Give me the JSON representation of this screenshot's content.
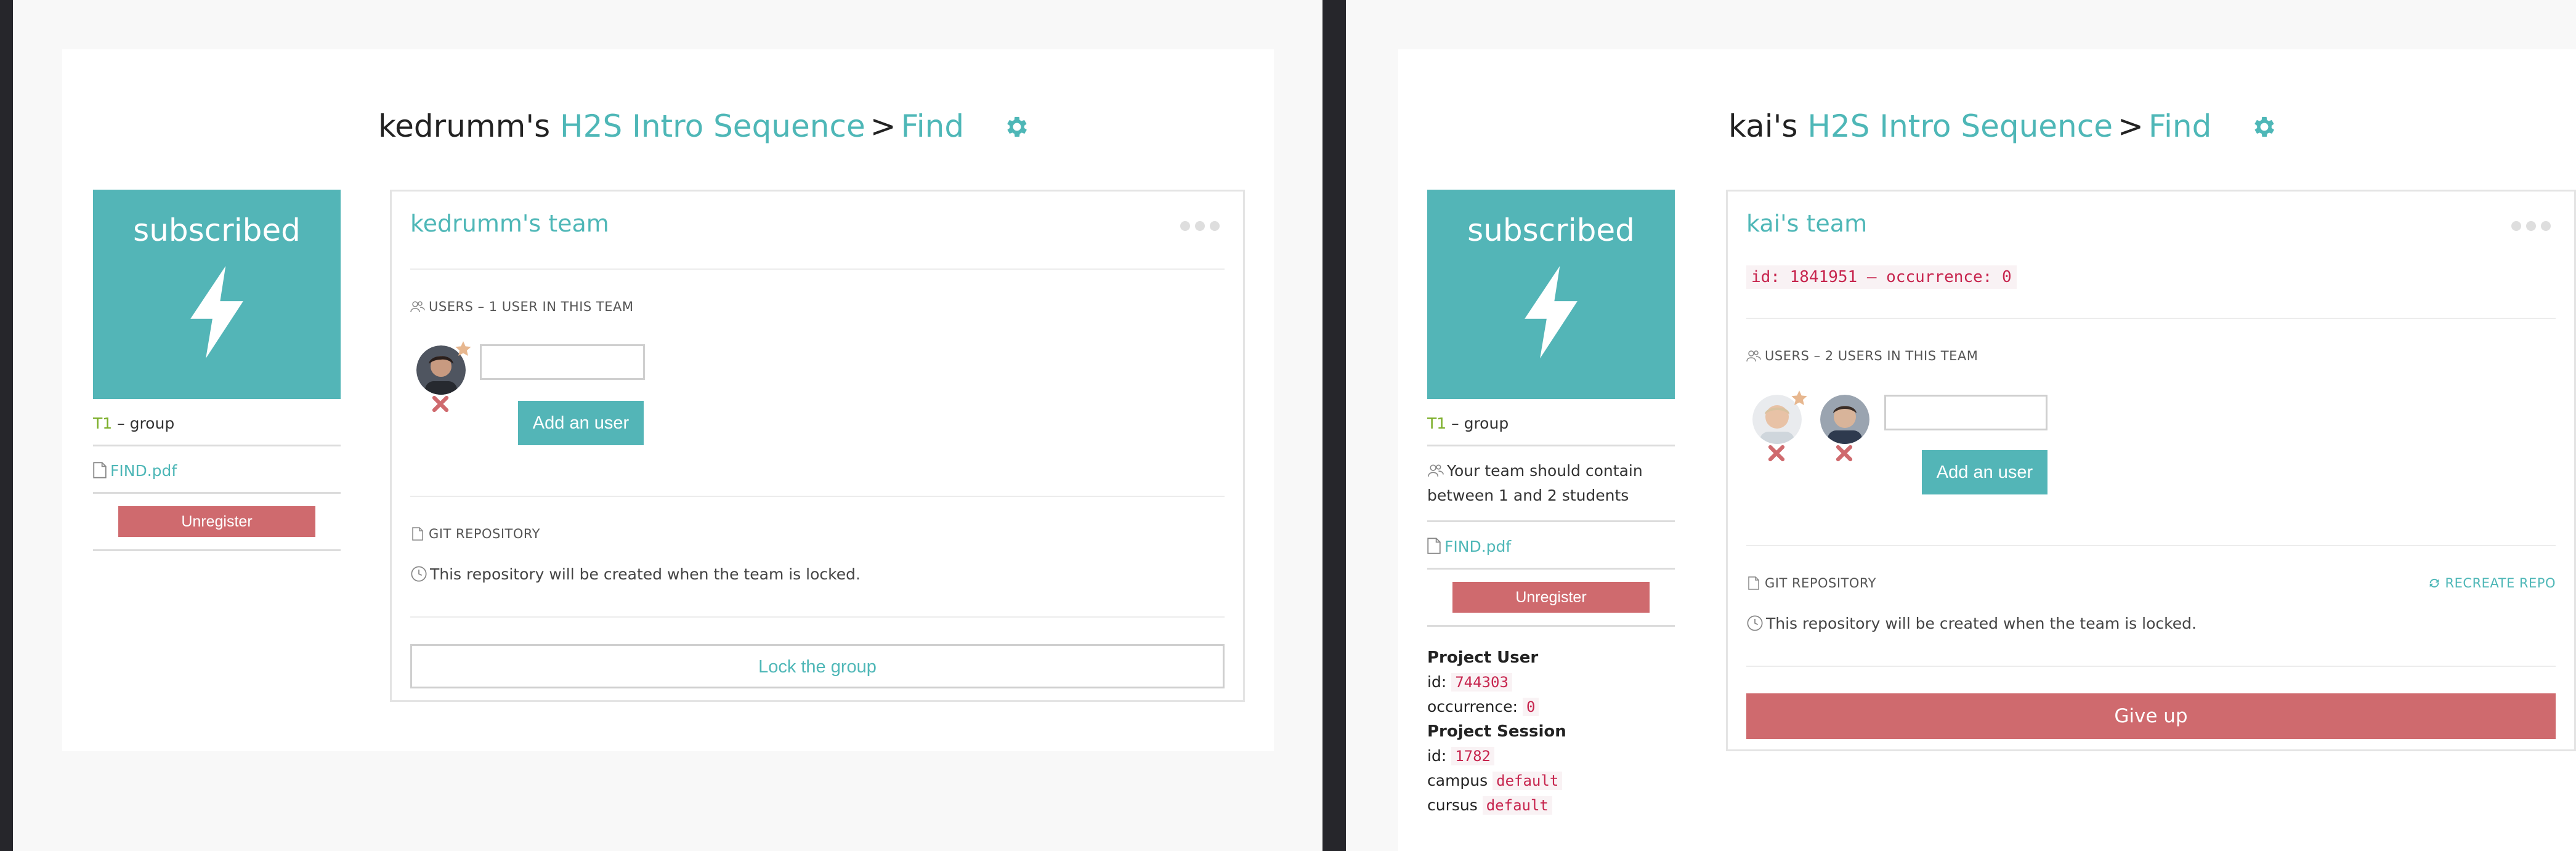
{
  "left": {
    "title": {
      "owner": "kedrumm's",
      "project": "H2S Intro Sequence",
      "separator": ">",
      "section": "Find"
    },
    "sidebar": {
      "status": "subscribed",
      "group_code": "T1",
      "group_suffix": " – group",
      "pdf_name": "FIND.pdf",
      "unregister": "Unregister"
    },
    "team": {
      "name": "kedrumm's team",
      "users_label": "USERS – 1 USER IN THIS TEAM",
      "add_user": "Add an user",
      "repo_label": "GIT REPOSITORY",
      "repo_note": "This repository will be created when the team is locked.",
      "lock": "Lock the group"
    }
  },
  "right": {
    "title": {
      "owner": "kai's",
      "project": "H2S Intro Sequence",
      "separator": ">",
      "section": "Find"
    },
    "sidebar": {
      "status": "subscribed",
      "group_code": "T1",
      "group_suffix": " – group",
      "team_size_note": "Your team should contain between 1 and 2 students",
      "pdf_name": "FIND.pdf",
      "unregister": "Unregister",
      "project_user": {
        "heading": "Project User",
        "id_label": "id:",
        "id": "744303",
        "occ_label": "occurrence:",
        "occurrence": "0"
      },
      "project_session": {
        "heading": "Project Session",
        "id_label": "id:",
        "id": "1782",
        "campus_label": "campus",
        "campus": "default",
        "cursus_label": "cursus",
        "cursus": "default"
      }
    },
    "team": {
      "name": "kai's team",
      "id_line": "id: 1841951 – occurrence: 0",
      "users_label": "USERS – 2 USERS IN THIS TEAM",
      "add_user": "Add an user",
      "repo_label": "GIT REPOSITORY",
      "recreate": "RECREATE REPO",
      "repo_note": "This repository will be created when the team is locked.",
      "give_up": "Give up"
    }
  },
  "colors": {
    "accent": "#53b5b7",
    "link": "#4eb7b7",
    "danger": "#cf6a6e",
    "group_code": "#7bae28"
  },
  "icons": [
    "gear-icon",
    "lightning-bolt-icon",
    "file-icon",
    "users-icon",
    "star-icon",
    "close-icon",
    "clock-icon",
    "refresh-icon",
    "more-dots-icon"
  ]
}
